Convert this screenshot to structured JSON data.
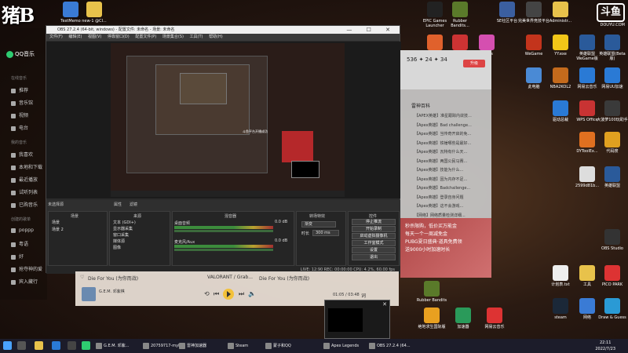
{
  "watermark": {
    "left": "猪B",
    "right": "斗鱼",
    "right_sub": "DOUYU.COM"
  },
  "desktop_icons_top": [
    {
      "label": "TextMemo",
      "color": "#3a7bd5"
    },
    {
      "label": "new-1 @Cl...",
      "color": "#e8c24b"
    },
    {
      "label": "EPIC Games Launcher",
      "color": "#222"
    },
    {
      "label": "Rubber Bandits...",
      "color": "#5a7a2a"
    },
    {
      "label": "SE社区平台",
      "color": "#3b5fa0"
    },
    {
      "label": "完美世界竞技平台",
      "color": "#444"
    },
    {
      "label": "Administr...",
      "color": "#e8c24b"
    },
    {
      "label": "Origin",
      "color": "#e0612c"
    },
    {
      "label": "Among Us",
      "color": "#c33"
    },
    {
      "label": "iTunes",
      "color": "#d54fb0"
    },
    {
      "label": "WeGame",
      "color": "#c3341c"
    },
    {
      "label": "YY.exe",
      "color": "#f2c618"
    },
    {
      "label": "英雄联盟WeGame版",
      "color": "#2a5a9a"
    },
    {
      "label": "英雄联盟(Beta版)",
      "color": "#2a5a9a"
    },
    {
      "label": "此电脑",
      "color": "#4a8ad5"
    },
    {
      "label": "NBA2KOL2",
      "color": "#c46a1c"
    },
    {
      "label": "网易云音乐",
      "color": "#2a7ad5"
    },
    {
      "label": "网易UU加速",
      "color": "#2a7ad5"
    },
    {
      "label": "驱动总裁",
      "color": "#2a7ad5"
    },
    {
      "label": "WPS Office",
      "color": "#c83333"
    },
    {
      "label": "大菠萝100玩助手",
      "color": "#3a3a3a"
    },
    {
      "label": "DYToolEx...",
      "color": "#e07020"
    },
    {
      "label": "代码搜",
      "color": "#e0a020"
    },
    {
      "label": "2599d81b...",
      "color": "#ddd"
    },
    {
      "label": "英雄联盟",
      "color": "#2a5a9a"
    },
    {
      "label": "OBS Studio",
      "color": "#333"
    },
    {
      "label": "计划表.txt",
      "color": "#eee"
    },
    {
      "label": "工具",
      "color": "#e8c24b"
    },
    {
      "label": "PICO PARK",
      "color": "#d33"
    },
    {
      "label": "steam",
      "color": "#1b2838"
    },
    {
      "label": "网络",
      "color": "#3a7bd5"
    },
    {
      "label": "Draw & Guess",
      "color": "#2a9ad5"
    },
    {
      "label": "绝地求生国际版",
      "color": "#e8a020"
    },
    {
      "label": "加速器",
      "color": "#2a9a5a"
    },
    {
      "label": "网易云音乐",
      "color": "#d33"
    },
    {
      "label": "Rubber Bandits",
      "color": "#5a7a2a"
    }
  ],
  "qqmusic": {
    "logo": "QQ音乐",
    "sec1": "在线音乐",
    "items1": [
      "推荐",
      "音乐馆",
      "视频",
      "电台"
    ],
    "sec2": "我的音乐",
    "items2": [
      "我喜欢",
      "本地和下载",
      "最近播放",
      "试听列表",
      "已购音乐"
    ],
    "sec3": "创建的歌单",
    "items3": [
      "poppp",
      "粤语",
      "好",
      "抢夺神的爱",
      "宾入藏行"
    ]
  },
  "obs": {
    "title": "OBS 27.2.4 (64-bit, windows) - 配置文件: 未命名 - 场景: 未命名",
    "menu": [
      "文件(F)",
      "编辑(E)",
      "视图(V)",
      "停靠窗口(D)",
      "配置文件(P)",
      "场景集合(S)",
      "工具(T)",
      "帮助(H)"
    ],
    "window_controls": "— ☐ ✕",
    "preview_label": "未选择源",
    "preview_tabs": [
      "属性",
      "滤镜"
    ],
    "inner_text": "斗鱼平台开播成功",
    "docks": {
      "scenes": {
        "header": "场景",
        "items": [
          "场景",
          "场景 2"
        ]
      },
      "sources": {
        "header": "来源",
        "items": [
          "文本 (GDI+)",
          "显示器采集",
          "窗口采集",
          "媒体源",
          "图像"
        ]
      },
      "mixer": {
        "header": "混音器",
        "rows": [
          {
            "label": "桌面音频",
            "db": "0.0 dB"
          },
          {
            "label": "麦克风/Aux",
            "db": "0.0 dB"
          }
        ]
      },
      "transitions": {
        "header": "转场特效",
        "type": "渐变",
        "duration_label": "时长",
        "duration": "300 ms"
      },
      "controls": {
        "header": "控件",
        "buttons": [
          "停止推流",
          "开始录制",
          "启动虚拟摄像机",
          "工作室模式",
          "设置",
          "退出"
        ]
      }
    },
    "status": "LIVE: 12:90   REC: 00:00:00   CPU: 4.2%, 60.00 fps"
  },
  "rpanel": {
    "score": "536 ✦ 24 ✦ 34",
    "button": "升级",
    "heading": "雷神百科",
    "items": [
      "【APEX英雄】准星跟踪内敛技...",
      "【Apex英雄】Bad challenge...",
      "【Apex英雄】当传奇开启的免...",
      "【Apex英雄】铁锤哪些是最好...",
      "【Apex英雄】瓦特有什么天...",
      "【Apex英雄】两国公民马赛...",
      "【Apex英雄】技能为什么...",
      "【Apex英雄】因为内存不足...",
      "【Apex英雄】Badchallenge...",
      "【Apex英雄】登录自身问题",
      "【Apex英雄】这不会游戏...",
      "【网络】网络质量检测详细..."
    ],
    "ad_lines": [
      "秒杀限购，低价买万能金",
      "每天一个一周减免金",
      "PUBG夏日盛典·道具免费领",
      "送9000小时加速时长"
    ]
  },
  "music": {
    "song": "Die For You (为你而战)",
    "mid": "VALORANT / Grab...",
    "song2": "Die For You (为你而战)",
    "artist": "G.E.M. 邓紫棋",
    "time": "01:05 / 03:48",
    "lyric_btn": "词"
  },
  "taskbar": {
    "buttons": [
      "G.E.M. 邓紫...",
      "20759717-myh...",
      "雷神加速器",
      "Steam",
      "蒙子和QQ",
      "Apex Legends",
      "OBS 27.2.4 (64..."
    ],
    "time": "22:11",
    "date": "2022/7/23"
  }
}
